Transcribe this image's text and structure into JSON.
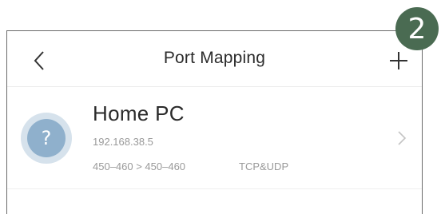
{
  "header": {
    "title": "Port Mapping",
    "back_icon": "chevron-left-icon",
    "add_icon": "plus-icon"
  },
  "mapping": {
    "device_name": "Home PC",
    "ip": "192.168.38.5",
    "ports": "450–460 > 450–460",
    "protocol": "TCP&UDP",
    "avatar_glyph": "?",
    "avatar_icon": "unknown-device-icon",
    "chevron_icon": "chevron-right-icon"
  },
  "badge": {
    "number": "2"
  },
  "colors": {
    "badge": "#4a6b52",
    "avatar_inner": "#8fb0cc",
    "avatar_ring": "#d6e2ec"
  }
}
